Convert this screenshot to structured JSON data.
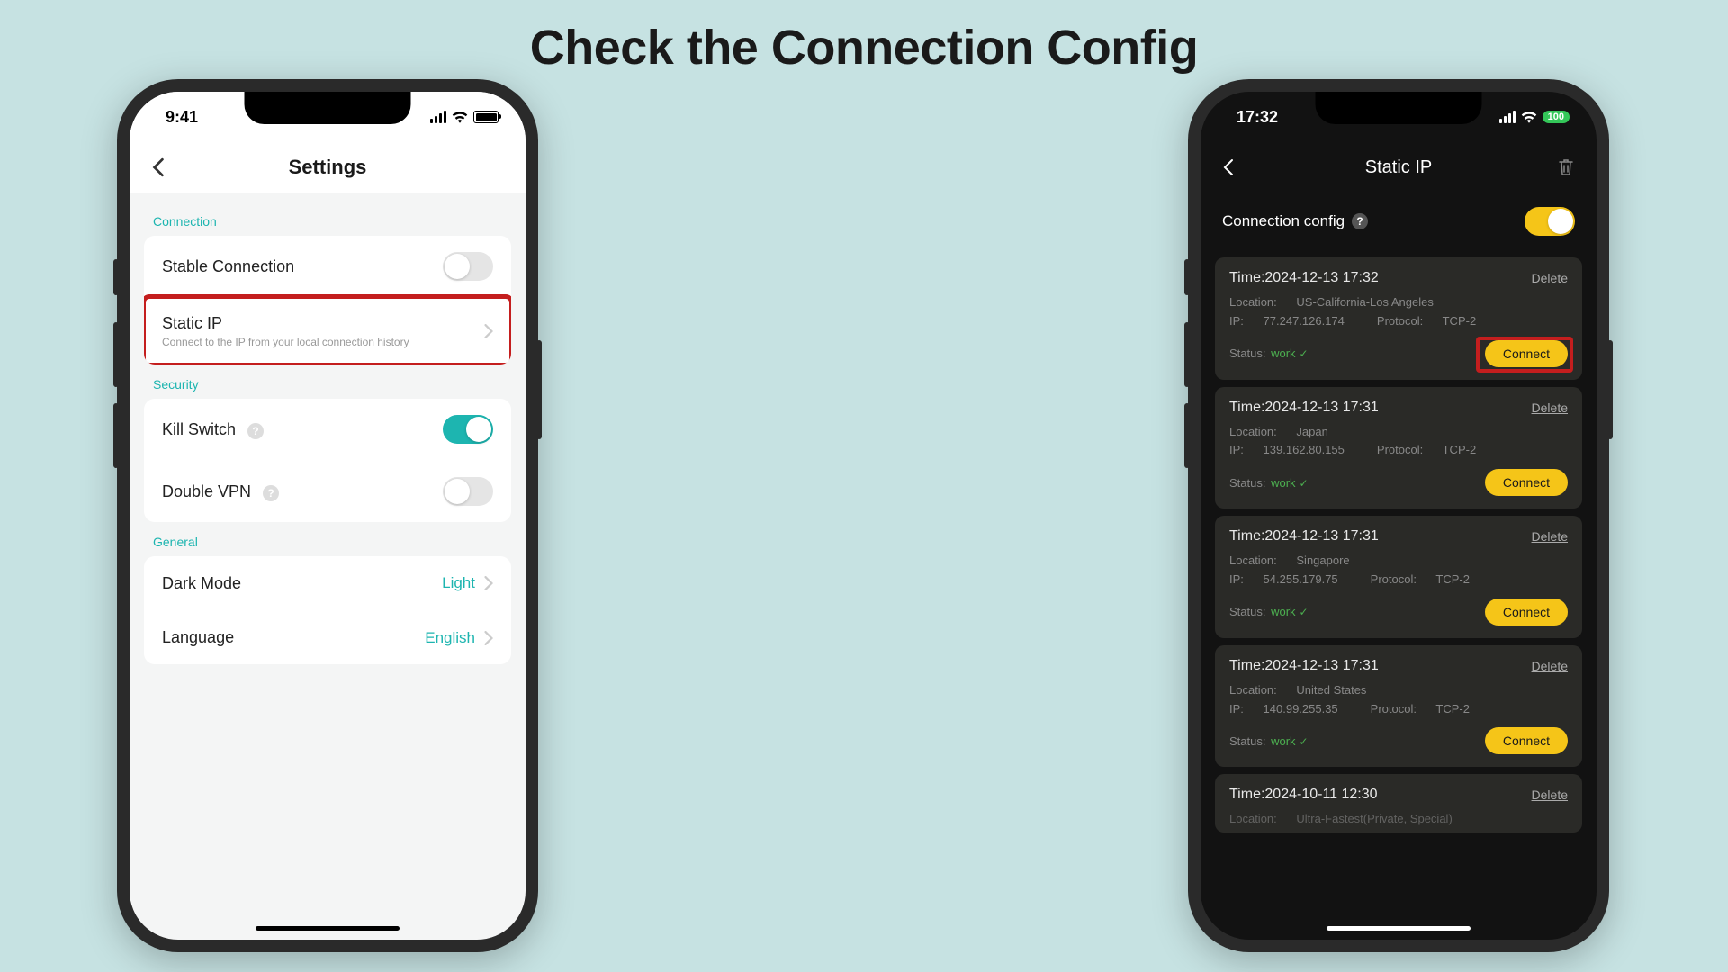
{
  "page": {
    "title": "Check the Connection Config"
  },
  "phone_light": {
    "status_time": "9:41",
    "nav_title": "Settings",
    "sections": {
      "connection": {
        "label": "Connection"
      },
      "security": {
        "label": "Security"
      },
      "general": {
        "label": "General"
      }
    },
    "rows": {
      "stable": {
        "title": "Stable Connection",
        "on": false
      },
      "static_ip": {
        "title": "Static IP",
        "subtitle": "Connect to the IP from your local connection history"
      },
      "kill_switch": {
        "title": "Kill Switch",
        "on": true
      },
      "double_vpn": {
        "title": "Double VPN",
        "on": false
      },
      "dark_mode": {
        "title": "Dark Mode",
        "value": "Light"
      },
      "language": {
        "title": "Language",
        "value": "English"
      }
    }
  },
  "phone_dark": {
    "status_time": "17:32",
    "battery": "100",
    "nav_title": "Static IP",
    "config_label": "Connection config",
    "config_on": true,
    "labels": {
      "time": "Time:",
      "location": "Location:",
      "ip": "IP:",
      "protocol": "Protocol:",
      "status": "Status:",
      "status_work": "work",
      "delete": "Delete",
      "connect": "Connect"
    },
    "entries": [
      {
        "time": "2024-12-13 17:32",
        "location": "US-California-Los Angeles",
        "ip": "77.247.126.174",
        "protocol": "TCP-2",
        "status": "work"
      },
      {
        "time": "2024-12-13 17:31",
        "location": "Japan",
        "ip": "139.162.80.155",
        "protocol": "TCP-2",
        "status": "work"
      },
      {
        "time": "2024-12-13 17:31",
        "location": "Singapore",
        "ip": "54.255.179.75",
        "protocol": "TCP-2",
        "status": "work"
      },
      {
        "time": "2024-12-13 17:31",
        "location": "United States",
        "ip": "140.99.255.35",
        "protocol": "TCP-2",
        "status": "work"
      },
      {
        "time": "2024-10-11 12:30",
        "location": "Ultra-Fastest(Private, Special)",
        "ip": "",
        "protocol": "",
        "status": ""
      }
    ]
  }
}
